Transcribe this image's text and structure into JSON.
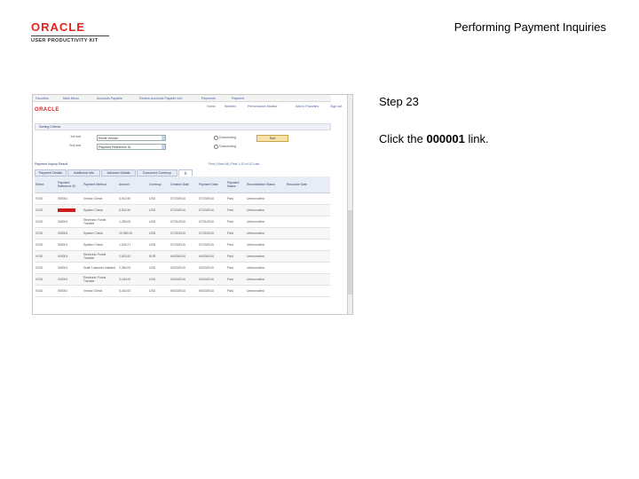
{
  "header": {
    "logo_word": "ORACLE",
    "logo_sub": "USER PRODUCTIVITY KIT",
    "doc_title": "Performing Payment Inquiries"
  },
  "step": {
    "label": "Step 23",
    "instr_pre": "Click the ",
    "instr_link": "000001",
    "instr_post": " link."
  },
  "thumb": {
    "nav_items": [
      "Favorites",
      "Main Menu",
      "Accounts Payable",
      "Review Accounts Payable Info",
      "Payments",
      "Payment"
    ],
    "oracle_logo": "ORACLE",
    "top_links": [
      "Home",
      "Worklist",
      "Performance Monitor",
      "Add to Favorites",
      "Sign out"
    ],
    "sort_header": "Sorting Criteria",
    "sort_rows": [
      {
        "label": "1st sort",
        "value": "Remit Vendor",
        "order1": "Descending",
        "order2": "Descending"
      },
      {
        "label": "2nd sort",
        "value": "Payment Reference ID",
        "order1": "Descending",
        "order2": "Descending"
      }
    ],
    "sort_btn": "Sort",
    "grid_title": "Payment Inquiry Result",
    "grid_tools": "Find | View All | First 1-10 of 10 Last",
    "tabs": [
      "Payment Details",
      "Additional Info",
      "Advance Details",
      "Document Currency",
      "|||"
    ],
    "columns": [
      "Select",
      "Payment Reference ID",
      "Payment Method",
      "Amount",
      "Currency",
      "Creation Date",
      "Payment Date",
      "Payment Status",
      "Reconciliation Status",
      "Reconcile Date"
    ],
    "rows": [
      {
        "select": "VOID",
        "ref": "000001",
        "method": "Vendor Check",
        "amount": "5,942.50",
        "currency": "USD",
        "created": "07/20/2010",
        "paydate": "07/20/2010",
        "status": "Paid",
        "recon": "Unreconciled"
      },
      {
        "select": "VOID",
        "ref": "000001",
        "method": "System Check",
        "amount": "5,942.50",
        "currency": "USD",
        "created": "07/20/2010",
        "paydate": "07/20/2010",
        "status": "Paid",
        "recon": "Unreconciled"
      },
      {
        "select": "VOID",
        "ref": "000001",
        "method": "Electronic Funds Transfer",
        "amount": "1,250.00",
        "currency": "USD",
        "created": "07/21/2010",
        "paydate": "07/21/2010",
        "status": "Paid",
        "recon": "Unreconciled"
      },
      {
        "select": "VOID",
        "ref": "000001",
        "method": "System Check",
        "amount": "10,950.00",
        "currency": "USD",
        "created": "07/22/2010",
        "paydate": "07/22/2010",
        "status": "Paid",
        "recon": "Unreconciled"
      },
      {
        "select": "VOID",
        "ref": "000001",
        "method": "System Check",
        "amount": "1,942.27",
        "currency": "USD",
        "created": "07/23/2010",
        "paydate": "07/23/2010",
        "status": "Paid",
        "recon": "Unreconciled"
      },
      {
        "select": "VOID",
        "ref": "000001",
        "method": "Electronic Funds Transfer",
        "amount": "2,503.52",
        "currency": "EUR",
        "created": "04/20/2010",
        "paydate": "04/20/2010",
        "status": "Paid",
        "recon": "Unreconciled"
      },
      {
        "select": "VOID",
        "ref": "000001",
        "method": "Draft Customer Initiated",
        "amount": "2,350.00",
        "currency": "USD",
        "created": "04/20/2010",
        "paydate": "04/20/2010",
        "status": "Paid",
        "recon": "Unreconciled"
      },
      {
        "select": "VOID",
        "ref": "000001",
        "method": "Electronic Funds Transfer",
        "amount": "3,150.00",
        "currency": "USD",
        "created": "04/20/2010",
        "paydate": "04/20/2010",
        "status": "Paid",
        "recon": "Unreconciled"
      },
      {
        "select": "VOID",
        "ref": "000001",
        "method": "Vendor Check",
        "amount": "5,443.00",
        "currency": "USD",
        "created": "09/20/2010",
        "paydate": "09/20/2010",
        "status": "Paid",
        "recon": "Unreconciled"
      }
    ]
  },
  "colors": {
    "oracle_red": "#e0261c",
    "link_blue": "#4a64a0",
    "highlight": "#cc1b1b"
  }
}
